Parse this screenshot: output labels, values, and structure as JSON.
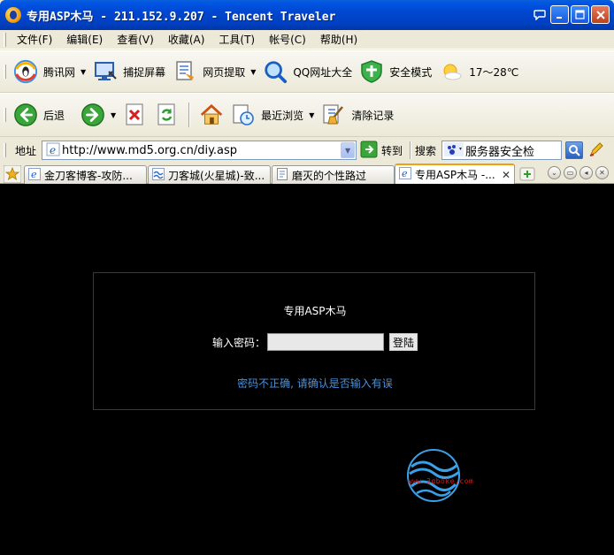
{
  "window": {
    "title": "专用ASP木马 - 211.152.9.207 - Tencent Traveler"
  },
  "menubar": {
    "items": [
      "文件(F)",
      "编辑(E)",
      "查看(V)",
      "收藏(A)",
      "工具(T)",
      "帐号(C)",
      "帮助(H)"
    ]
  },
  "toolbar1": {
    "tencent_label": "腾讯网",
    "capture_label": "捕捉屏幕",
    "extract_label": "网页提取",
    "qq_label": "QQ网址大全",
    "safe_label": "安全模式",
    "weather_label": "17～28℃"
  },
  "toolbar2": {
    "back_label": "后退",
    "recent_label": "最近浏览",
    "clear_label": "清除记录"
  },
  "address": {
    "label": "地址",
    "url": "http://www.md5.org.cn/diy.asp",
    "go_label": "转到",
    "search_label": "搜索",
    "search_value": "服务器安全检"
  },
  "tabs": [
    {
      "label": "金刀客博客-攻防...",
      "active": false
    },
    {
      "label": "刀客城(火星城)-致...",
      "active": false
    },
    {
      "label": "磨灭的个性路过",
      "active": false
    },
    {
      "label": "专用ASP木马 -...",
      "active": true
    }
  ],
  "page": {
    "title": "专用ASP木马",
    "password_label": "输入密码：",
    "login_button": "登陆",
    "error_message": "密码不正确, 请确认是否输入有误",
    "watermark_text": "www.3qboke.com"
  },
  "colors": {
    "titlebar": "#0047d0",
    "content_bg": "#000000",
    "error_text": "#4a90d9"
  }
}
